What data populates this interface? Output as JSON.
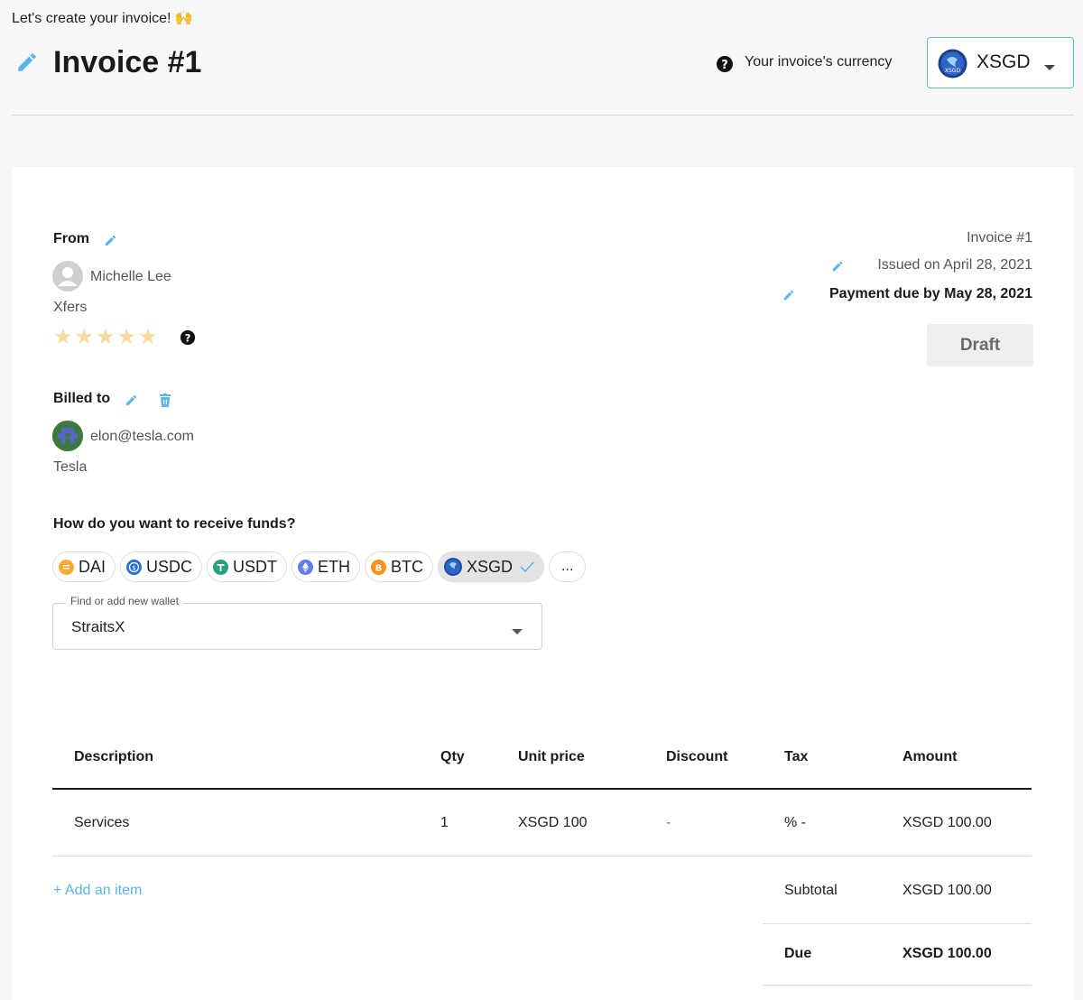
{
  "header": {
    "intro": "Let's create your invoice! 🙌",
    "title": "Invoice #1",
    "currency_label": "Your invoice's currency",
    "currency_value": "XSGD"
  },
  "from": {
    "label": "From",
    "name": "Michelle Lee",
    "company": "Xfers",
    "rating_stars": "★★★★★"
  },
  "billed_to": {
    "label": "Billed to",
    "email": "elon@tesla.com",
    "company": "Tesla"
  },
  "invoice_meta": {
    "number": "Invoice #1",
    "issued": "Issued on April 28, 2021",
    "due": "Payment due by May 28, 2021",
    "status_button": "Draft"
  },
  "funds": {
    "question": "How do you want to receive funds?",
    "chips": [
      {
        "label": "DAI",
        "icon": "dai-icon",
        "color": "#f5ac37"
      },
      {
        "label": "USDC",
        "icon": "usdc-icon",
        "color": "#2775ca"
      },
      {
        "label": "USDT",
        "icon": "usdt-icon",
        "color": "#26a17b"
      },
      {
        "label": "ETH",
        "icon": "eth-icon",
        "color": "#627eea"
      },
      {
        "label": "BTC",
        "icon": "btc-icon",
        "color": "#f7931a"
      },
      {
        "label": "XSGD",
        "icon": "xsgd-icon",
        "color": "#1e4fa3"
      }
    ],
    "more_label": "...",
    "wallet_legend": "Find or add new wallet",
    "wallet_value": "StraitsX"
  },
  "table": {
    "headers": {
      "description": "Description",
      "qty": "Qty",
      "unit_price": "Unit price",
      "discount": "Discount",
      "tax": "Tax",
      "amount": "Amount"
    },
    "row": {
      "description": "Services",
      "qty": "1",
      "unit_price": "XSGD 100",
      "discount": "-",
      "tax": "% -",
      "amount": "XSGD 100.00"
    },
    "add_item": "+ Add an item",
    "subtotal_label": "Subtotal",
    "subtotal_value": "XSGD 100.00",
    "due_label": "Due",
    "due_value": "XSGD 100.00"
  },
  "colors": {
    "accent": "#5ab6e8",
    "select_border": "#5fb8e5",
    "star": "#f6dba0"
  }
}
